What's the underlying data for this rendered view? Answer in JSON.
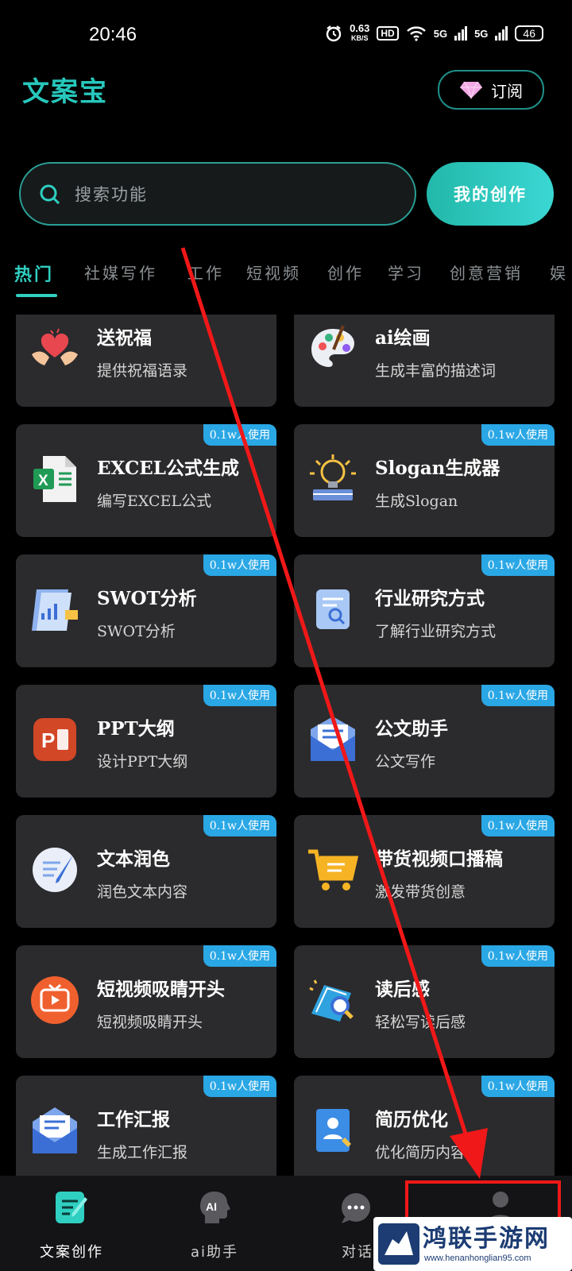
{
  "status_bar": {
    "time": "20:46",
    "speed_value": "0.63",
    "speed_unit": "KB/S",
    "hd": "HD",
    "sig1": "5G",
    "sig2": "5G",
    "battery": "46"
  },
  "header": {
    "logo": "文案宝",
    "subscribe_label": "订阅"
  },
  "search": {
    "placeholder": "搜索功能",
    "my_creations_label": "我的创作"
  },
  "tabs": [
    "热门",
    "社媒写作",
    "工作",
    "短视频",
    "创作",
    "学习",
    "创意营销",
    "娱"
  ],
  "cards": [
    {
      "title": "送祝福",
      "desc": "提供祝福语录",
      "badge": "",
      "icon": "heart-hands-icon"
    },
    {
      "title": "ai绘画",
      "desc": "生成丰富的描述词",
      "badge": "",
      "icon": "palette-icon"
    },
    {
      "title": "EXCEL公式生成",
      "desc": "编写EXCEL公式",
      "badge": "0.1w人使用",
      "icon": "excel-file-icon"
    },
    {
      "title": "Slogan生成器",
      "desc": "生成Slogan",
      "badge": "0.1w人使用",
      "icon": "lightbulb-icon"
    },
    {
      "title": "SWOT分析",
      "desc": "SWOT分析",
      "badge": "0.1w人使用",
      "icon": "document-chart-icon"
    },
    {
      "title": "行业研究方式",
      "desc": "了解行业研究方式",
      "badge": "0.1w人使用",
      "icon": "research-doc-icon"
    },
    {
      "title": "PPT大纲",
      "desc": "设计PPT大纲",
      "badge": "0.1w人使用",
      "icon": "ppt-icon"
    },
    {
      "title": "公文助手",
      "desc": "公文写作",
      "badge": "0.1w人使用",
      "icon": "envelope-icon"
    },
    {
      "title": "文本润色",
      "desc": "润色文本内容",
      "badge": "0.1w人使用",
      "icon": "quill-document-icon"
    },
    {
      "title": "带货视频口播稿",
      "desc": "激发带货创意",
      "badge": "0.1w人使用",
      "icon": "shopping-cart-icon"
    },
    {
      "title": "短视频吸睛开头",
      "desc": "短视频吸睛开头",
      "badge": "0.1w人使用",
      "icon": "tv-play-icon"
    },
    {
      "title": "读后感",
      "desc": "轻松写读后感",
      "badge": "0.1w人使用",
      "icon": "book-magnifier-icon"
    },
    {
      "title": "工作汇报",
      "desc": "生成工作汇报",
      "badge": "0.1w人使用",
      "icon": "mail-report-icon"
    },
    {
      "title": "简历优化",
      "desc": "优化简历内容",
      "badge": "0.1w人使用",
      "icon": "resume-icon"
    }
  ],
  "bottom_nav": [
    "文案创作",
    "ai助手",
    "对话",
    ""
  ],
  "watermark": {
    "title": "鸿联手游网",
    "url": "www.henanhonglian95.com"
  },
  "colors": {
    "accent": "#2fcfc1",
    "badge": "#2aa7e5",
    "card_bg": "#2b2b2d",
    "annotation_red": "#f01818"
  }
}
